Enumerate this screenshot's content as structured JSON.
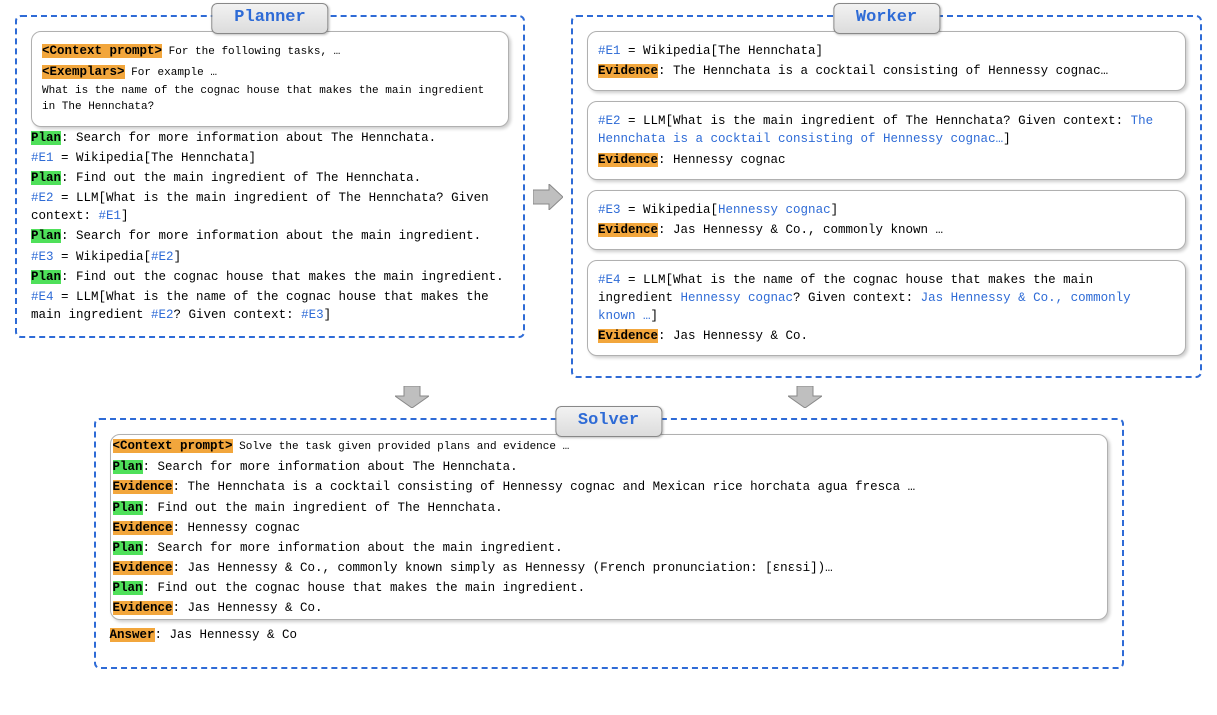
{
  "titles": {
    "planner": "Planner",
    "worker": "Worker",
    "solver": "Solver"
  },
  "labels": {
    "context_prompt": "<Context prompt>",
    "exemplars": "<Exemplars>",
    "plan": "Plan",
    "evidence": "Evidence",
    "answer": "Answer"
  },
  "planner": {
    "context_tail": " For the following tasks, …",
    "exemplars_tail": " For example …",
    "question": "What is the name of the cognac house that makes the main ingredient in The Hennchata?",
    "p1": ": Search for more information about The Hennchata.",
    "e1_id": "#E1",
    "e1_rest": " = Wikipedia[The Hennchata]",
    "p2": ": Find out the main ingredient of The Hennchata.",
    "e2_id": "#E2",
    "e2_rest_a": " = LLM[What is the main ingredient of The Hennchata? Given context: ",
    "e2_ref": "#E1",
    "e2_rest_b": "]",
    "p3": ": Search for more information about the main ingredient.",
    "e3_id": "#E3",
    "e3_rest_a": " = Wikipedia[",
    "e3_ref": "#E2",
    "e3_rest_b": "]",
    "p4": ": Find out the cognac house that makes the main ingredient.",
    "e4_id": "#E4",
    "e4_rest_a": " = LLM[What is the name of the cognac house that makes the main ingredient ",
    "e4_ref1": "#E2",
    "e4_rest_b": "? Given context: ",
    "e4_ref2": "#E3",
    "e4_rest_c": "]"
  },
  "worker": {
    "c1": {
      "id": "#E1",
      "call": " = Wikipedia[The Hennchata]",
      "ev": ": The Hennchata is a cocktail consisting of Hennessy cognac…"
    },
    "c2": {
      "id": "#E2",
      "call_a": " = LLM[What is the main ingredient of The Hennchata? Given context: ",
      "call_ctx": "The Hennchata is a cocktail consisting of Hennessy cognac…",
      "call_b": "]",
      "ev": ": Hennessy cognac"
    },
    "c3": {
      "id": "#E3",
      "call_a": " = Wikipedia[",
      "call_arg": "Hennessy cognac",
      "call_b": "]",
      "ev": ": Jas Hennessy & Co., commonly known …"
    },
    "c4": {
      "id": "#E4",
      "call_a": " = LLM[What is the name of the cognac house that makes the main ingredient ",
      "call_arg1": "Hennessy cognac",
      "call_b": "? Given context: ",
      "call_arg2": "Jas Hennessy & Co., commonly known …",
      "call_c": "]",
      "ev": ": Jas Hennessy & Co."
    }
  },
  "solver": {
    "context_tail": " Solve the task given provided plans and evidence …",
    "p1": ": Search for more information about The Hennchata.",
    "e1": ": The Hennchata is a cocktail consisting of Hennessy cognac and Mexican rice horchata agua fresca …",
    "p2": ": Find out the main ingredient of The Hennchata.",
    "e2": ": Hennessy cognac",
    "p3": ": Search for more information about the main ingredient.",
    "e3": ": Jas Hennessy & Co., commonly known simply as Hennessy (French pronunciation: [ɛnɛsi])…",
    "p4": ": Find out the cognac house that makes the main ingredient.",
    "e4": ": Jas Hennessy & Co.",
    "answer": ": Jas Hennessy & Co"
  }
}
